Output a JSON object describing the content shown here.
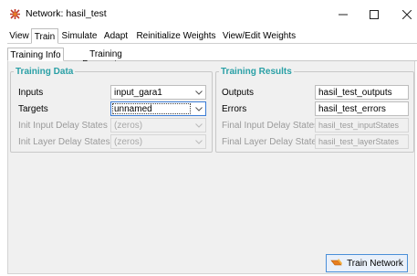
{
  "window": {
    "title": "Network: hasil_test"
  },
  "tabs": [
    "View",
    "Train",
    "Simulate",
    "Adapt",
    "Reinitialize Weights",
    "View/Edit Weights"
  ],
  "subtabs": [
    "Training Info",
    "Training Parameters"
  ],
  "training_data": {
    "title": "Training Data",
    "inputs_label": "Inputs",
    "inputs_value": "input_gara1",
    "targets_label": "Targets",
    "targets_value": "unnamed",
    "init_input_delay_label": "Init Input Delay States",
    "init_input_delay_value": "(zeros)",
    "init_layer_delay_label": "Init Layer Delay States",
    "init_layer_delay_value": "(zeros)"
  },
  "training_results": {
    "title": "Training Results",
    "outputs_label": "Outputs",
    "outputs_value": "hasil_test_outputs",
    "errors_label": "Errors",
    "errors_value": "hasil_test_errors",
    "final_input_delay_label": "Final Input Delay States",
    "final_input_delay_value": "hasil_test_inputStates",
    "final_layer_delay_label": "Final Layer Delay States",
    "final_layer_delay_value": "hasil_test_layerStates"
  },
  "train_button": {
    "label": "Train Network"
  },
  "icons": {
    "app": "network-icon",
    "minimize": "minimize-icon",
    "maximize": "maximize-icon",
    "close": "close-icon",
    "dropdown": "chevron-down-icon",
    "train": "train-icon"
  },
  "colors": {
    "group_title": "#2aa0a6",
    "accent": "#4a8fd8"
  }
}
